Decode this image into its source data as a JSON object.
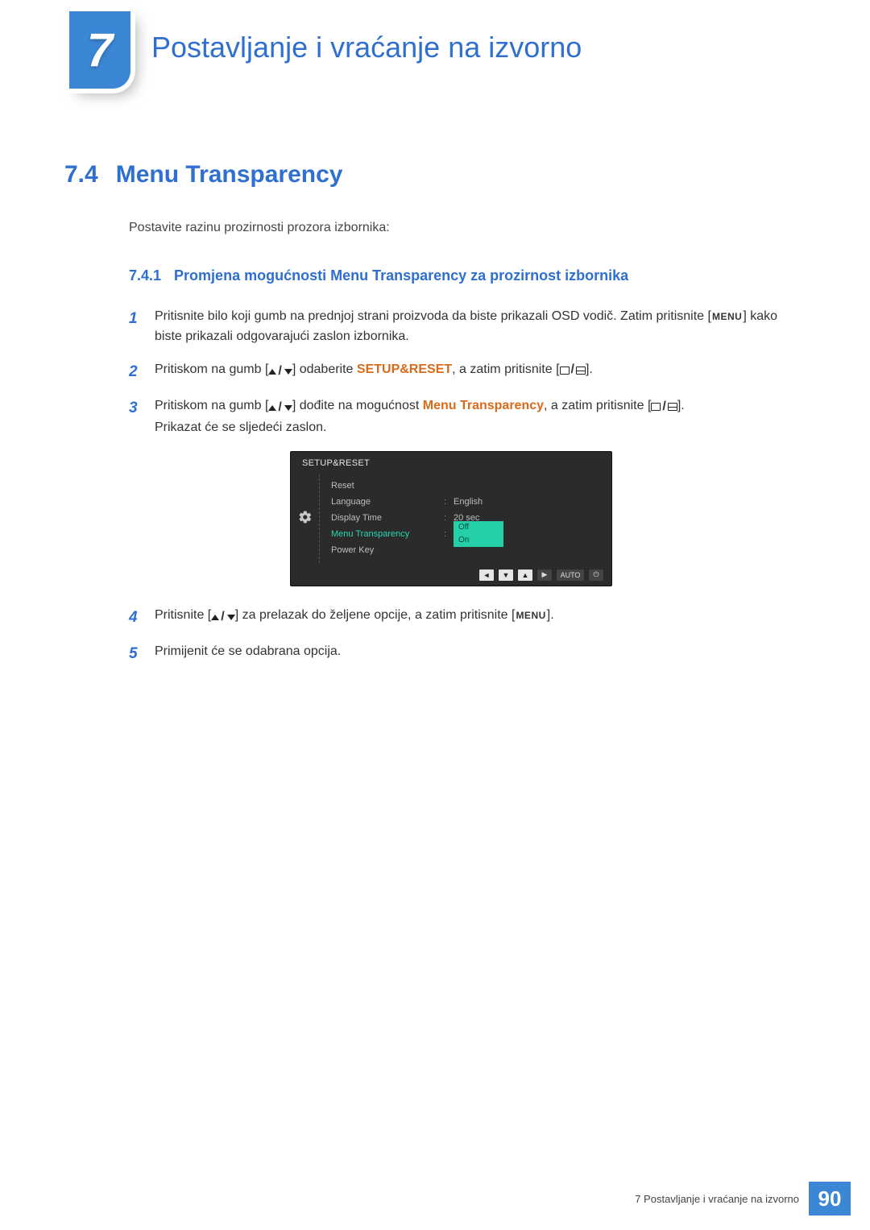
{
  "chapter": {
    "number": "7",
    "title": "Postavljanje i vraćanje na izvorno"
  },
  "section": {
    "number": "7.4",
    "title": "Menu Transparency"
  },
  "intro": "Postavite razinu prozirnosti prozora izbornika:",
  "subsection": {
    "number": "7.4.1",
    "title": "Promjena mogućnosti Menu Transparency za prozirnost izbornika"
  },
  "steps": [
    {
      "n": "1",
      "pre": "Pritisnite bilo koji gumb na prednjoj strani proizvoda da biste prikazali OSD vodič. Zatim pritisnite [",
      "menu": "MENU",
      "post": "] kako biste prikazali odgovarajući zaslon izbornika."
    },
    {
      "n": "2",
      "pre": "Pritiskom na gumb [",
      "mid": "] odaberite ",
      "highlight": "SETUP&RESET",
      "post2": ", a zatim pritisnite [",
      "tail": "]."
    },
    {
      "n": "3",
      "pre": "Pritiskom na gumb [",
      "mid": "] dođite na mogućnost ",
      "highlight": "Menu Transparency",
      "post2": ", a zatim pritisnite [",
      "tail": "].",
      "extra": "Prikazat će se sljedeći zaslon."
    },
    {
      "n": "4",
      "pre": "Pritisnite [",
      "mid": "] za prelazak do željene opcije, a zatim pritisnite [",
      "menu": "MENU",
      "tail": "]."
    },
    {
      "n": "5",
      "text": "Primijenit će se odabrana opcija."
    }
  ],
  "osd": {
    "title": "SETUP&RESET",
    "rows": [
      {
        "label": "Reset",
        "value": ""
      },
      {
        "label": "Language",
        "sep": ":",
        "value": "English"
      },
      {
        "label": "Display Time",
        "sep": ":",
        "value": "20 sec"
      },
      {
        "label": "Menu Transparency",
        "sep": ":",
        "highlight": true,
        "options": [
          "Off",
          "On"
        ]
      },
      {
        "label": "Power Key",
        "value": ""
      }
    ],
    "ctrl_auto": "AUTO"
  },
  "footer": {
    "text": "7 Postavljanje i vraćanje na izvorno",
    "page": "90"
  },
  "glyphs": {
    "slash": "/"
  }
}
